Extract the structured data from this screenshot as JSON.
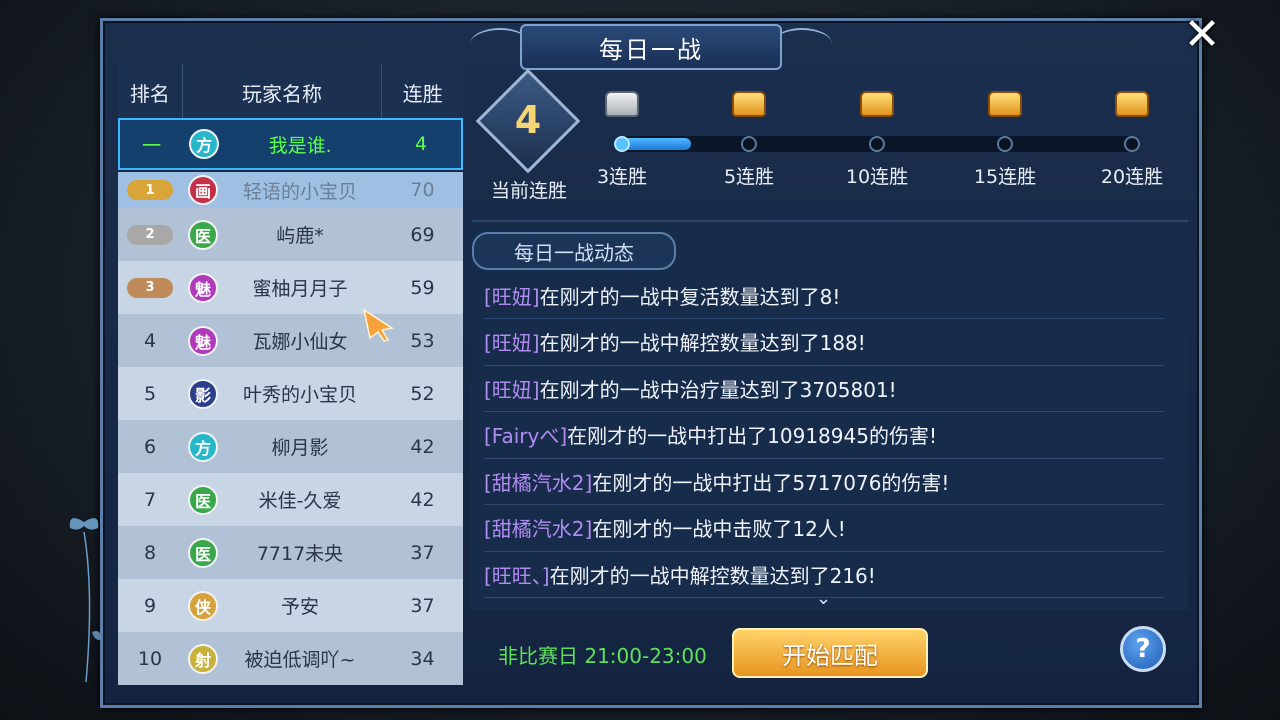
{
  "title": "每日一战",
  "close_symbol": "✕",
  "leaderboard": {
    "headers": {
      "rank": "排名",
      "name": "玩家名称",
      "streak": "连胜"
    },
    "me": {
      "rank": "一",
      "class": "方",
      "class_color": "#28b6c9",
      "name": "我是谁.",
      "streak": "4"
    },
    "rows": [
      {
        "rank": "1",
        "medal": true,
        "class": "画",
        "class_color": "#c4304a",
        "name": "轻语的小宝贝",
        "streak": "70",
        "style": "first"
      },
      {
        "rank": "2",
        "medal": true,
        "class": "医",
        "class_color": "#3aa84a",
        "name": "屿鹿*",
        "streak": "69",
        "style": "even"
      },
      {
        "rank": "3",
        "medal": true,
        "class": "魅",
        "class_color": "#b03aba",
        "name": "蜜柚月月子",
        "streak": "59",
        "style": "odd"
      },
      {
        "rank": "4",
        "class": "魅",
        "class_color": "#b03aba",
        "name": "瓦娜小仙女",
        "streak": "53",
        "style": "even"
      },
      {
        "rank": "5",
        "class": "影",
        "class_color": "#2c3f8a",
        "name": "叶秀的小宝贝",
        "streak": "52",
        "style": "odd"
      },
      {
        "rank": "6",
        "class": "方",
        "class_color": "#28b6c9",
        "name": "柳月影",
        "streak": "42",
        "style": "even"
      },
      {
        "rank": "7",
        "class": "医",
        "class_color": "#3aa84a",
        "name": "米佳-久爱",
        "streak": "42",
        "style": "odd"
      },
      {
        "rank": "8",
        "class": "医",
        "class_color": "#3aa84a",
        "name": "7717未央",
        "streak": "37",
        "style": "even"
      },
      {
        "rank": "9",
        "class": "侠",
        "class_color": "#d8a23a",
        "name": "予安",
        "streak": "37",
        "style": "odd"
      },
      {
        "rank": "10",
        "class": "射",
        "class_color": "#c8b23a",
        "name": "被迫低调吖~",
        "streak": "34",
        "style": "even"
      }
    ]
  },
  "current_streak": {
    "value": "4",
    "label": "当前连胜"
  },
  "milestones": [
    {
      "label": "3连胜",
      "chest": "silver",
      "done": true
    },
    {
      "label": "5连胜",
      "chest": "gold",
      "done": false
    },
    {
      "label": "10连胜",
      "chest": "gold",
      "done": false
    },
    {
      "label": "15连胜",
      "chest": "gold",
      "done": false
    },
    {
      "label": "20连胜",
      "chest": "gold",
      "done": false
    }
  ],
  "progress_fraction": 0.14,
  "feed": {
    "title": "每日一战动态",
    "items": [
      {
        "who": "[旺妞]",
        "text": "在刚才的一战中复活数量达到了8!"
      },
      {
        "who": "[旺妞]",
        "text": "在刚才的一战中解控数量达到了188!"
      },
      {
        "who": "[旺妞]",
        "text": "在刚才的一战中治疗量达到了3705801!"
      },
      {
        "who": "[Fairyべ]",
        "text": "在刚才的一战中打出了10918945的伤害!"
      },
      {
        "who": "[甜橘汽水2]",
        "text": "在刚才的一战中打出了5717076的伤害!"
      },
      {
        "who": "[甜橘汽水2]",
        "text": "在刚才的一战中击败了12人!"
      },
      {
        "who": "[旺旺、]",
        "text": "在刚才的一战中解控数量达到了216!"
      }
    ]
  },
  "schedule": "非比赛日 21:00-23:00",
  "match_button": "开始匹配",
  "help_symbol": "?",
  "more_symbol": "⌄"
}
